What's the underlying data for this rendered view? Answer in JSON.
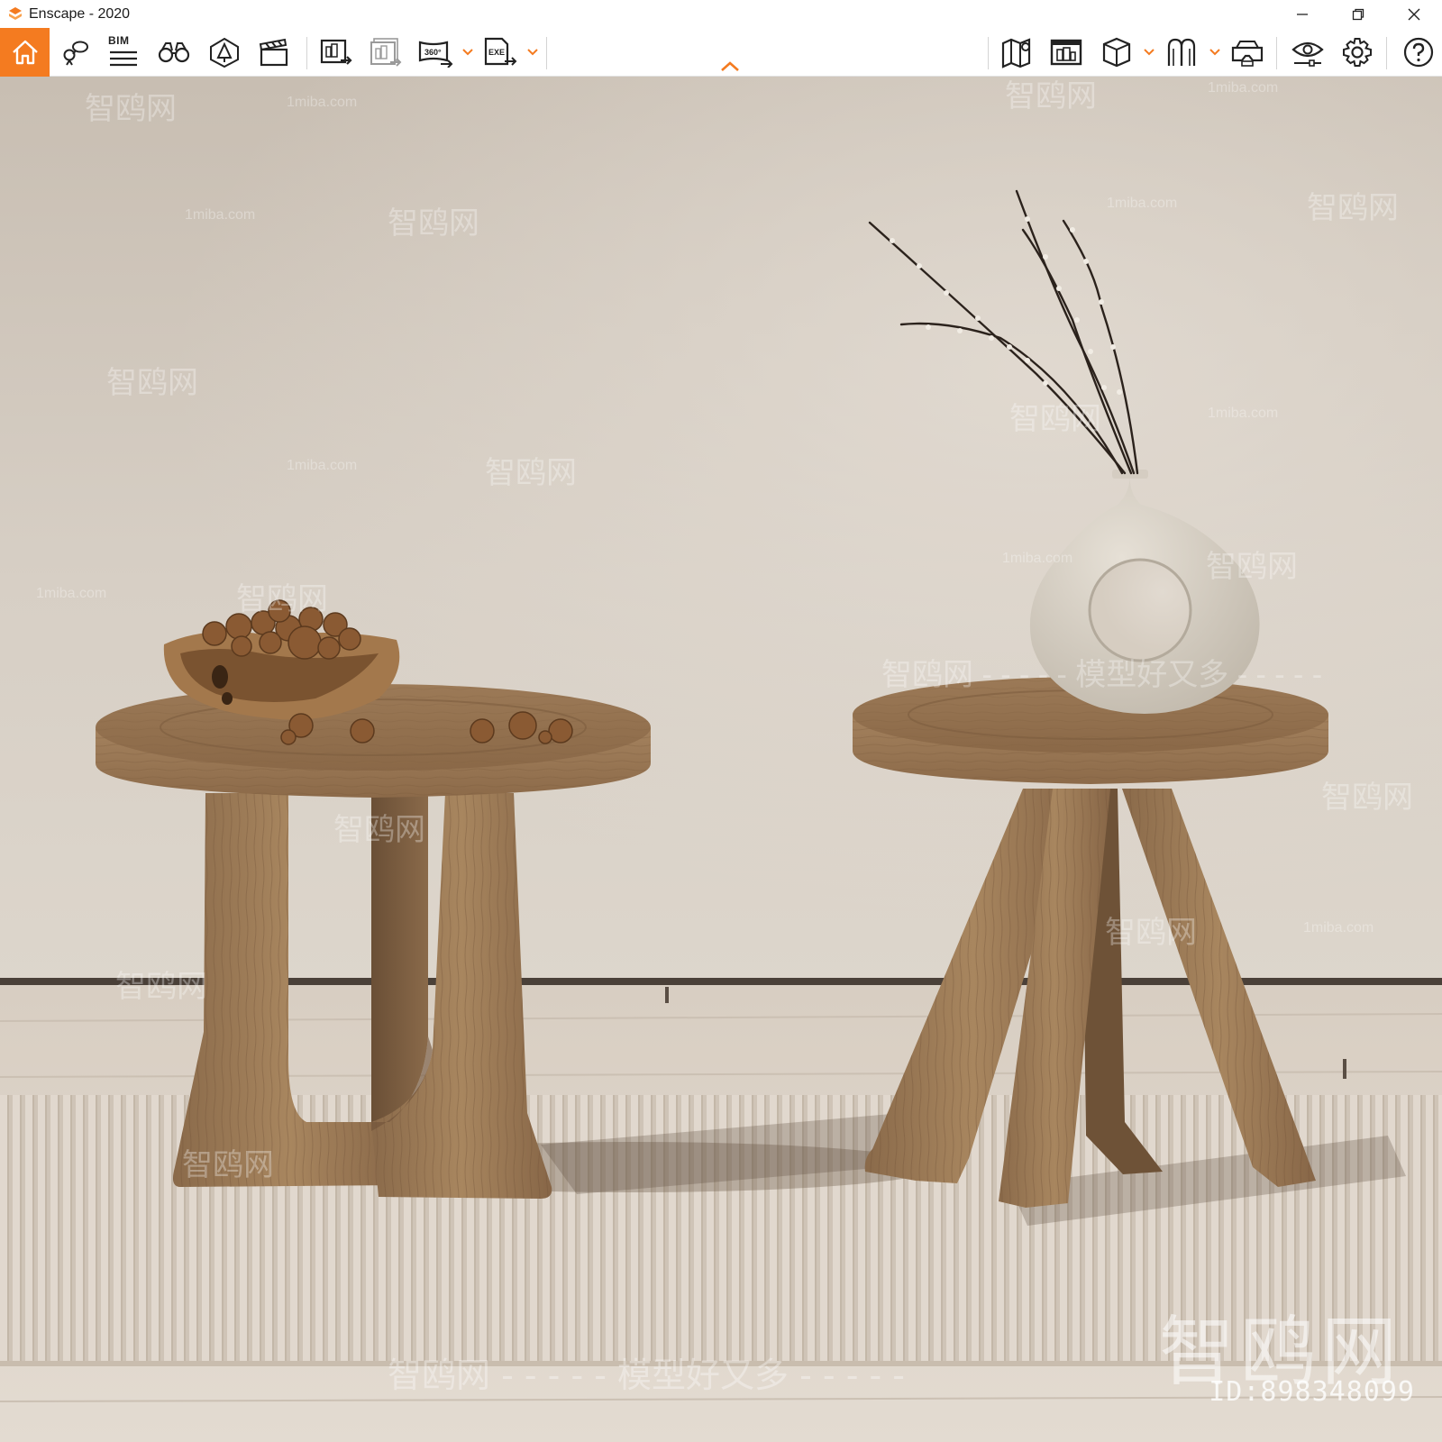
{
  "window": {
    "title": "Enscape - 2020",
    "accent": "#f47b20"
  },
  "toolbar": {
    "bim_label": "BIM",
    "left_tools": [
      {
        "name": "home",
        "icon": "home-icon"
      },
      {
        "name": "views",
        "icon": "location-views-icon"
      },
      {
        "name": "bim",
        "icon": "bim-list-icon"
      },
      {
        "name": "binoculars",
        "icon": "binoculars-icon"
      },
      {
        "name": "asset-library",
        "icon": "tree-asset-icon"
      },
      {
        "name": "video",
        "icon": "clapperboard-icon"
      },
      {
        "name": "screenshot",
        "icon": "render-image-icon"
      },
      {
        "name": "batch-render",
        "icon": "batch-render-icon"
      },
      {
        "name": "panorama",
        "icon": "panorama-360-icon"
      },
      {
        "name": "export-exe",
        "icon": "export-exe-icon"
      }
    ],
    "right_tools": [
      {
        "name": "map",
        "icon": "map-icon"
      },
      {
        "name": "render-window",
        "icon": "render-window-icon"
      },
      {
        "name": "cube",
        "icon": "cube-icon"
      },
      {
        "name": "clip",
        "icon": "clip-icon"
      },
      {
        "name": "vr",
        "icon": "vr-headset-icon"
      },
      {
        "name": "visual-settings",
        "icon": "eye-settings-icon"
      },
      {
        "name": "settings",
        "icon": "gear-icon"
      },
      {
        "name": "help",
        "icon": "help-icon"
      }
    ]
  },
  "watermarks": {
    "site": "1miba.com",
    "brand": "智鸥网",
    "slogan": "智鸥网 - - - - - 模型好又多 - - - - -",
    "big": "智鸥网",
    "id": "ID:898348099"
  }
}
